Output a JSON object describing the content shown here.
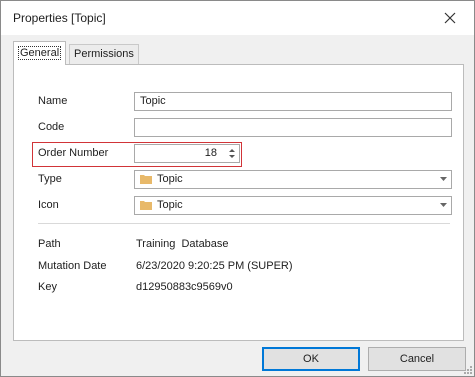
{
  "window": {
    "title": "Properties [Topic]"
  },
  "tabs": [
    {
      "label": "General",
      "active": true
    },
    {
      "label": "Permissions",
      "active": false
    }
  ],
  "form": {
    "name": {
      "label": "Name",
      "value": "Topic"
    },
    "code": {
      "label": "Code",
      "value": ""
    },
    "order_number": {
      "label": "Order Number",
      "value": "18"
    },
    "type": {
      "label": "Type",
      "value": "Topic",
      "icon": "folder-icon"
    },
    "icon": {
      "label": "Icon",
      "value": "Topic",
      "icon": "folder-icon"
    }
  },
  "info": {
    "path": {
      "label": "Path",
      "value": "Training  Database"
    },
    "mutation_date": {
      "label": "Mutation Date",
      "value": "6/23/2020 9:20:25 PM (SUPER)"
    },
    "key": {
      "label": "Key",
      "value": "d12950883c9569v0"
    }
  },
  "buttons": {
    "ok": "OK",
    "cancel": "Cancel"
  },
  "colors": {
    "highlight_border": "#d13438",
    "default_button_border": "#0078d7",
    "folder": "#e8b96a"
  }
}
